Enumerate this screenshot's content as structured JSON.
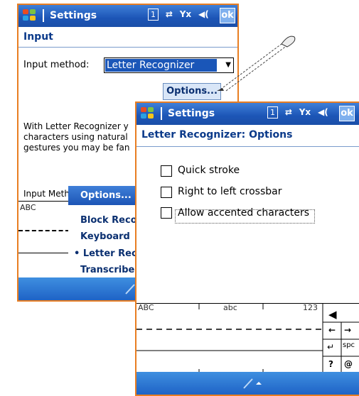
{
  "back": {
    "title": "Settings",
    "ok": "ok",
    "icon1": "1",
    "page_title": "Input",
    "input_method_label": "Input method:",
    "input_method_value": "Letter Recognizer",
    "options_button": "Options...",
    "description": "With Letter Recognizer y characters using natural gestures you may be fan",
    "input_method_tab": "Input Meth",
    "abc": "ABC",
    "menu": {
      "header": "Options...",
      "items": [
        "Block Reco",
        "Keyboard",
        "• Letter Rec",
        "Transcribe"
      ]
    }
  },
  "front": {
    "title": "Settings",
    "ok": "ok",
    "icon1": "1",
    "page_title": "Letter Recognizer: Options",
    "checkboxes": [
      {
        "label": "Quick stroke",
        "checked": false
      },
      {
        "label": "Right to left crossbar",
        "checked": false
      },
      {
        "label": "Allow accented characters",
        "checked": false
      }
    ],
    "kbd": {
      "abc_upper": "ABC",
      "abc_lower": "abc",
      "num": "123",
      "keys": [
        "←",
        "→",
        "spc",
        "?",
        "@"
      ]
    }
  },
  "colors": {
    "title_blue": "#1c55b6",
    "window_border": "#e87e22",
    "heading_text": "#0b3a8a"
  }
}
